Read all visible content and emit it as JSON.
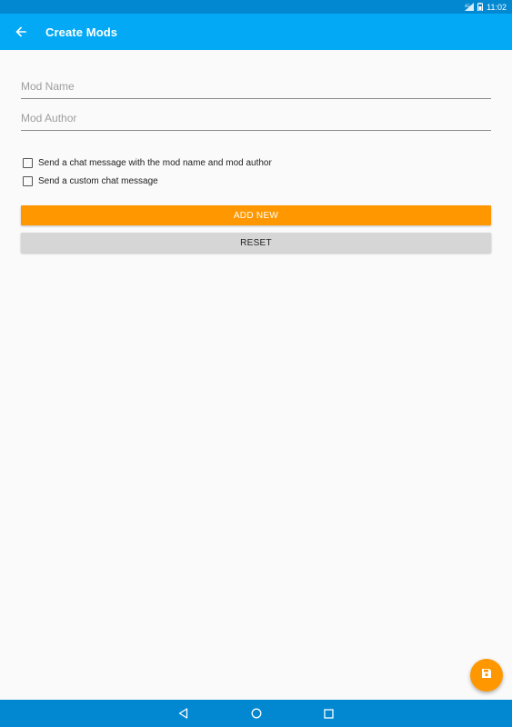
{
  "status_bar": {
    "time": "11:02",
    "icons": [
      "signal-icon",
      "battery-icon"
    ]
  },
  "app_bar": {
    "title": "Create Mods",
    "back_icon": "arrow-back-icon"
  },
  "form": {
    "mod_name": {
      "value": "",
      "placeholder": "Mod Name"
    },
    "mod_author": {
      "value": "",
      "placeholder": "Mod Author"
    },
    "checkboxes": [
      {
        "label": "Send a chat message with the mod name and mod author",
        "checked": false
      },
      {
        "label": "Send a custom chat message",
        "checked": false
      }
    ],
    "add_button_label": "ADD NEW",
    "reset_button_label": "RESET"
  },
  "fab": {
    "icon": "save-icon"
  },
  "nav_bar": {
    "icons": [
      "nav-back-icon",
      "nav-home-icon",
      "nav-recents-icon"
    ]
  },
  "colors": {
    "primary": "#03a9f4",
    "primary_dark": "#0288d1",
    "accent": "#ff9800",
    "button_grey": "#d6d6d6"
  }
}
